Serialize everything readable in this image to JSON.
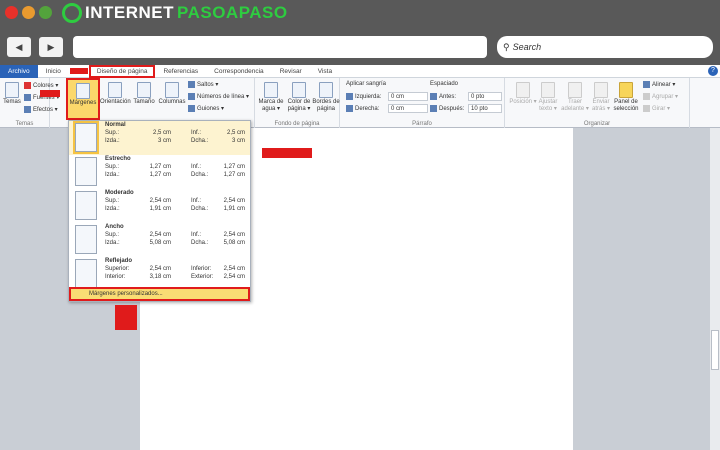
{
  "browser": {
    "logo_text_a": "INTERNET",
    "logo_text_b": "PASOAPASO",
    "back": "◀",
    "forward": "▶",
    "url": "",
    "search_placeholder": "Search"
  },
  "tabs": [
    "Archivo",
    "Inicio",
    "Diseño de página",
    "Referencias",
    "Correspondencia",
    "Revisar",
    "Vista"
  ],
  "ribbon": {
    "temas": {
      "label": "Temas",
      "temas": "Temas",
      "colores": "Colores ▾",
      "fuentes": "Fuentes ▾",
      "efectos": "Efectos ▾"
    },
    "config": {
      "margenes": "Márgenes",
      "orientacion": "Orientación",
      "tamano": "Tamaño",
      "columnas": "Columnas",
      "saltos": "Saltos ▾",
      "numeros": "Números de línea ▾",
      "guiones": "Guiones ▾"
    },
    "fondo": {
      "label": "Fondo de página",
      "marca": "Marca de agua ▾",
      "color": "Color de página ▾",
      "bordes": "Bordes de página"
    },
    "parrafo": {
      "label": "Párrafo",
      "sangria": "Aplicar sangría",
      "izquierda": "Izquierda:",
      "izquierda_val": "0 cm",
      "derecha": "Derecha:",
      "derecha_val": "0 cm",
      "espaciado": "Espaciado",
      "antes": "Antes:",
      "antes_val": "0 pto",
      "despues": "Después:",
      "despues_val": "10 pto"
    },
    "organizar": {
      "label": "Organizar",
      "posicion": "Posición ▾",
      "ajustar": "Ajustar texto ▾",
      "traer": "Traer adelante ▾",
      "enviar": "Enviar atrás ▾",
      "panel": "Panel de selección",
      "alinear": "Alinear ▾",
      "agrupar": "Agrupar ▾",
      "girar": "Girar ▾"
    }
  },
  "margins_menu": {
    "items": [
      {
        "name": "Normal",
        "l1": [
          "Sup.:",
          "2,5 cm",
          "Inf.:",
          "2,5 cm"
        ],
        "l2": [
          "Izda.:",
          "3 cm",
          "Dcha.:",
          "3 cm"
        ],
        "selected": true
      },
      {
        "name": "Estrecho",
        "l1": [
          "Sup.:",
          "1,27 cm",
          "Inf.:",
          "1,27 cm"
        ],
        "l2": [
          "Izda.:",
          "1,27 cm",
          "Dcha.:",
          "1,27 cm"
        ]
      },
      {
        "name": "Moderado",
        "l1": [
          "Sup.:",
          "2,54 cm",
          "Inf.:",
          "2,54 cm"
        ],
        "l2": [
          "Izda.:",
          "1,91 cm",
          "Dcha.:",
          "1,91 cm"
        ]
      },
      {
        "name": "Ancho",
        "l1": [
          "Sup.:",
          "2,54 cm",
          "Inf.:",
          "2,54 cm"
        ],
        "l2": [
          "Izda.:",
          "5,08 cm",
          "Dcha.:",
          "5,08 cm"
        ]
      },
      {
        "name": "Reflejado",
        "l1": [
          "Superior:",
          "2,54 cm",
          "Inferior:",
          "2,54 cm"
        ],
        "l2": [
          "Interior:",
          "3,18 cm",
          "Exterior:",
          "2,54 cm"
        ]
      }
    ],
    "custom": "Márgenes personalizados..."
  },
  "colors": {
    "highlight": "#e01b1b",
    "accent": "#2a63b8",
    "brand_green": "#2ecc40"
  }
}
